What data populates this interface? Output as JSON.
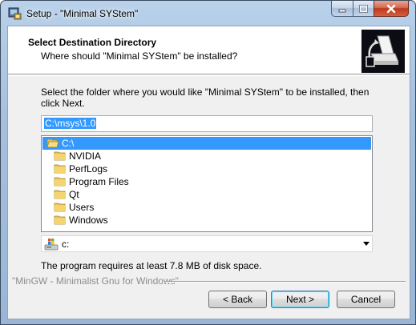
{
  "window": {
    "title": "Setup - \"Minimal SYStem\""
  },
  "header": {
    "title": "Select Destination Directory",
    "subtitle": "Where should \"Minimal SYStem\" be installed?"
  },
  "body": {
    "intro": "Select the folder where you would like \"Minimal SYStem\" to be installed, then click Next.",
    "path_value": "C:\\msys\\1.0",
    "folders": [
      {
        "label": "C:\\",
        "selected": true
      },
      {
        "label": "NVIDIA",
        "selected": false
      },
      {
        "label": "PerfLogs",
        "selected": false
      },
      {
        "label": "Program Files",
        "selected": false
      },
      {
        "label": "Qt",
        "selected": false
      },
      {
        "label": "Users",
        "selected": false
      },
      {
        "label": "Windows",
        "selected": false
      }
    ],
    "drive": "c:",
    "disk_space": "The program requires at least 7.8 MB of disk space."
  },
  "footer": {
    "branding": "\"MinGW - Minimalist Gnu for Windows\"",
    "back_label": "< Back",
    "next_label": "Next >",
    "cancel_label": "Cancel"
  },
  "colors": {
    "selection": "#3399ff",
    "folder": "#e8c15a"
  }
}
